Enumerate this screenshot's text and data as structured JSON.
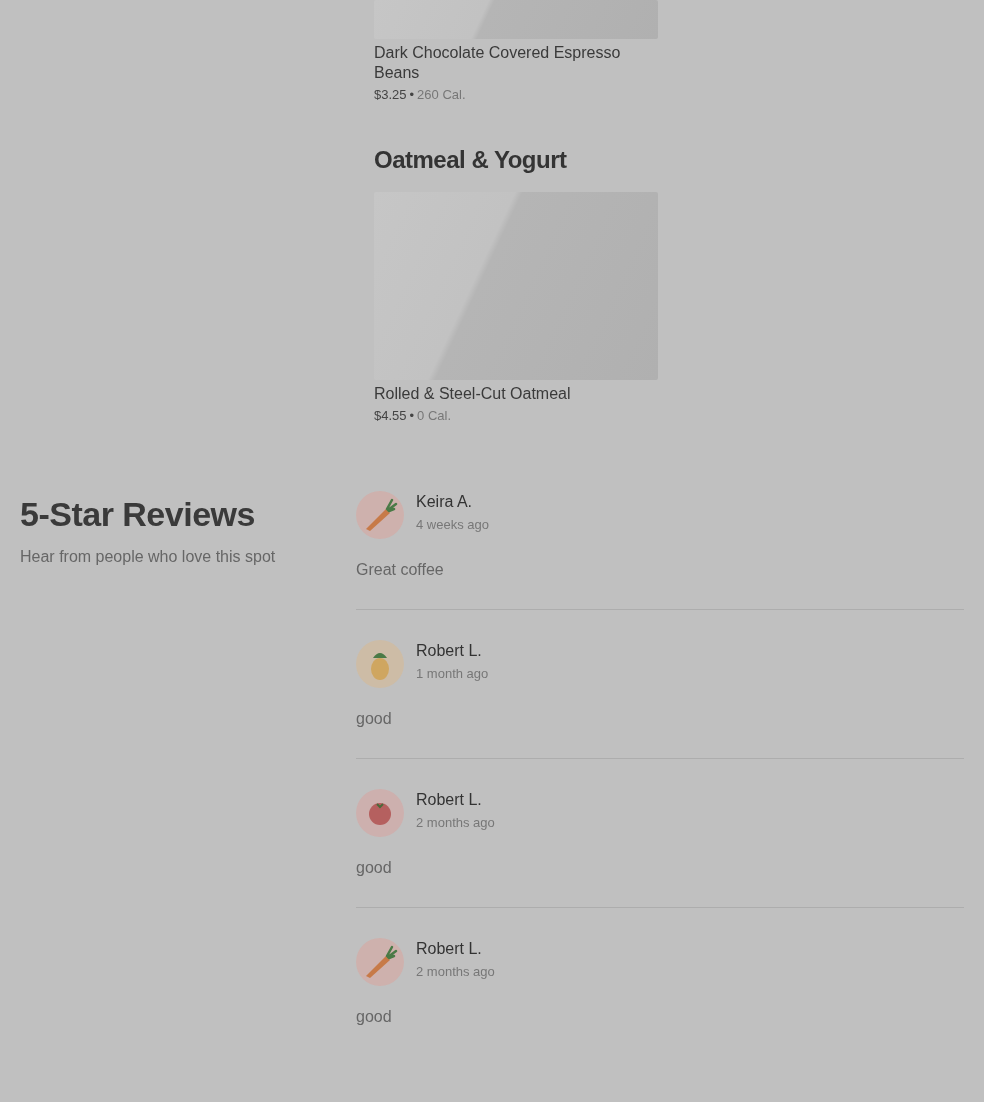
{
  "menu_sections": [
    {
      "items": [
        {
          "name": "Dark Chocolate Covered Espresso Beans",
          "price": "$3.25",
          "separator": "•",
          "calories": "260 Cal."
        }
      ]
    },
    {
      "title": "Oatmeal & Yogurt",
      "items": [
        {
          "name": "Rolled & Steel-Cut Oatmeal",
          "price": "$4.55",
          "separator": "•",
          "calories": "0 Cal."
        }
      ]
    }
  ],
  "reviews_section": {
    "title": "5-Star Reviews",
    "subtitle": "Hear from people who love this spot"
  },
  "reviews": [
    {
      "kind": "carrot",
      "author": "Keira A.",
      "time": "4 weeks ago",
      "text": "Great coffee"
    },
    {
      "kind": "pineapple",
      "author": "Robert L.",
      "time": "1 month ago",
      "text": "good"
    },
    {
      "kind": "tomato",
      "author": "Robert L.",
      "time": "2 months ago",
      "text": "good"
    },
    {
      "kind": "carrot",
      "author": "Robert L.",
      "time": "2 months ago",
      "text": "good"
    }
  ]
}
